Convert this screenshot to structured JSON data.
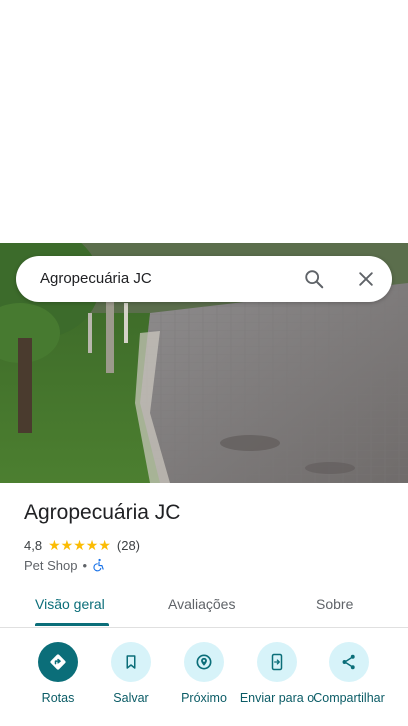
{
  "search": {
    "query": "Agropecuária JC"
  },
  "place": {
    "title": "Agropecuária JC",
    "rating": "4,8",
    "stars": 5,
    "review_count": "(28)",
    "category": "Pet Shop",
    "separator": "•"
  },
  "tabs": [
    {
      "label": "Visão geral",
      "active": true
    },
    {
      "label": "Avaliações",
      "active": false
    },
    {
      "label": "Sobre",
      "active": false
    }
  ],
  "actions": [
    {
      "label": "Rotas",
      "icon": "directions-icon"
    },
    {
      "label": "Salvar",
      "icon": "bookmark-icon"
    },
    {
      "label": "Próximo",
      "icon": "nearby-icon"
    },
    {
      "label": "Enviar para o",
      "icon": "send-to-phone-icon"
    },
    {
      "label": "Compartilhar",
      "icon": "share-icon"
    }
  ],
  "colors": {
    "accent": "#0b6e79",
    "action_bg": "#d7f3f9",
    "star": "#fbbc04",
    "accessibility": "#1a73e8"
  }
}
